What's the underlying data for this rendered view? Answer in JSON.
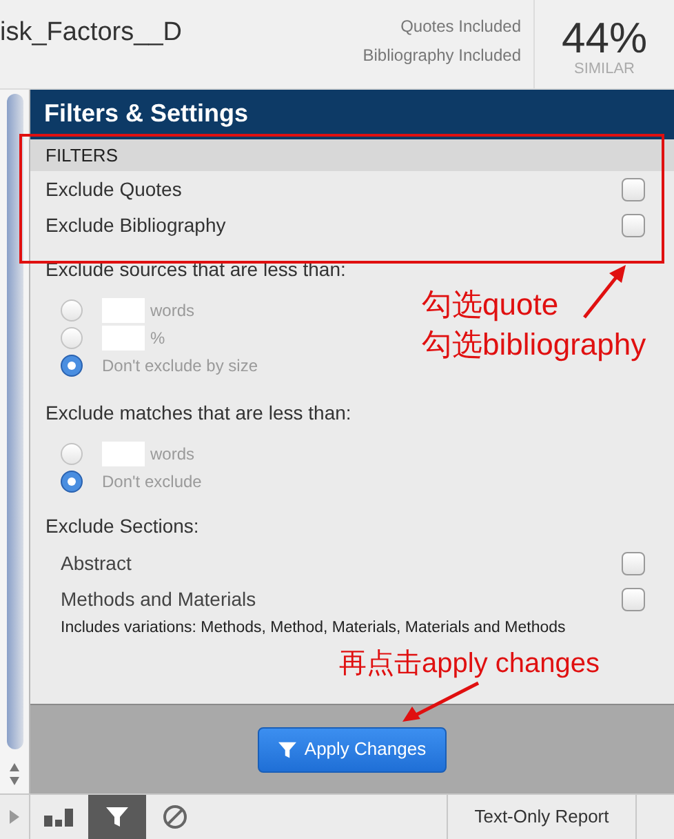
{
  "header": {
    "title": "isk_Factors__D",
    "status_lines": [
      "Quotes Included",
      "Bibliography Included"
    ],
    "score": "44%",
    "score_label": "SIMILAR"
  },
  "panel": {
    "title": "Filters & Settings",
    "filters": {
      "heading": "FILTERS",
      "items": [
        {
          "label": "Exclude Quotes",
          "checked": false
        },
        {
          "label": "Exclude Bibliography",
          "checked": false
        }
      ]
    },
    "source_size": {
      "heading": "Exclude sources that are less than:",
      "options": [
        {
          "kind": "input",
          "unit": "words",
          "selected": false
        },
        {
          "kind": "input",
          "unit": "%",
          "selected": false
        },
        {
          "kind": "plain",
          "label": "Don't exclude by size",
          "selected": true
        }
      ]
    },
    "match_size": {
      "heading": "Exclude matches that are less than:",
      "options": [
        {
          "kind": "input",
          "unit": "words",
          "selected": false
        },
        {
          "kind": "plain",
          "label": "Don't exclude",
          "selected": true
        }
      ]
    },
    "sections": {
      "heading": "Exclude Sections:",
      "items": [
        {
          "label": "Abstract",
          "checked": false
        },
        {
          "label": "Methods and Materials",
          "checked": false
        }
      ],
      "note": "Includes variations: Methods, Method, Materials, Materials and Methods"
    },
    "apply_button": "Apply Changes"
  },
  "toolbar": {
    "tools": [
      {
        "kind": "chart",
        "selected": false
      },
      {
        "kind": "filter",
        "selected": true
      },
      {
        "kind": "block",
        "selected": false
      }
    ],
    "report_button": "Text-Only Report"
  },
  "annotations": {
    "check_note": [
      "勾选quote",
      "勾选bibliography"
    ],
    "apply_note": "再点击apply changes"
  }
}
